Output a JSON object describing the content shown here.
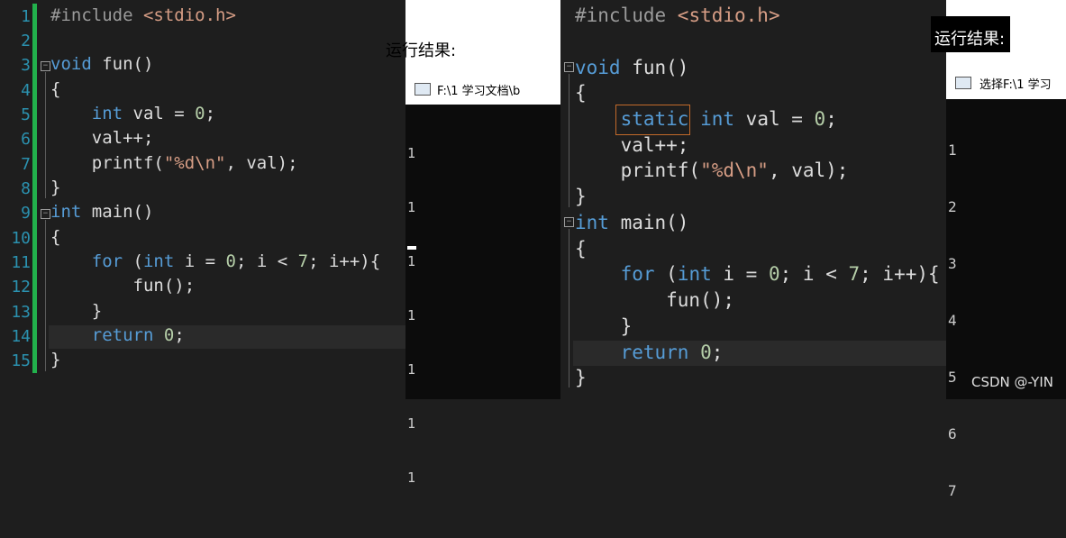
{
  "left_editor": {
    "line_numbers": [
      "1",
      "2",
      "3",
      "4",
      "5",
      "6",
      "7",
      "8",
      "9",
      "10",
      "11",
      "12",
      "13",
      "14",
      "15"
    ],
    "lines": [
      "#include <stdio.h>",
      "",
      "void fun()",
      "{",
      "    int val = 0;",
      "    val++;",
      "    printf(\"%d\\n\", val);",
      "}",
      "int main()",
      "{",
      "    for (int i = 0; i < 7; i++){",
      "        fun();",
      "    }",
      "    return 0;",
      "}"
    ]
  },
  "left_result_label": "运行结果:",
  "left_console": {
    "title": "F:\\1 学习文档\\b",
    "output": [
      "1",
      "1",
      "1",
      "1",
      "1",
      "1",
      "1"
    ]
  },
  "right_editor": {
    "lines": [
      "#include <stdio.h>",
      "",
      "void fun()",
      "{",
      "    static int val = 0;",
      "    val++;",
      "    printf(\"%d\\n\", val);",
      "}",
      "int main()",
      "{",
      "    for (int i = 0; i < 7; i++){",
      "        fun();",
      "    }",
      "    return 0;",
      "}"
    ]
  },
  "right_result_label": "运行结果:",
  "right_console": {
    "title": "选择F:\\1 学习",
    "output": [
      "1",
      "2",
      "3",
      "4",
      "5",
      "6",
      "7"
    ]
  },
  "watermark": "CSDN @-YIN",
  "colors": {
    "keyword": "#569cd6",
    "number": "#b5cea8",
    "string": "#d69d85",
    "line_number": "#2b91af",
    "change_bar": "#22b14c",
    "highlight_box": "#c26a2a"
  }
}
